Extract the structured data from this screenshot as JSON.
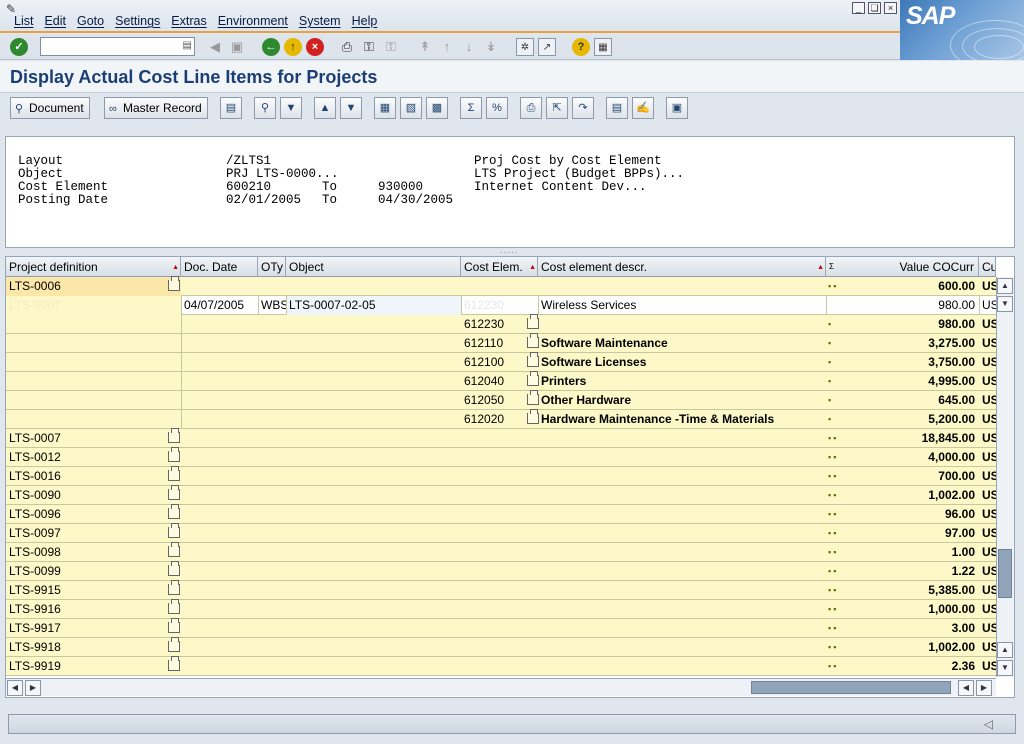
{
  "menu": [
    "List",
    "Edit",
    "Goto",
    "Settings",
    "Extras",
    "Environment",
    "System",
    "Help"
  ],
  "brand": "SAP",
  "page_title": "Display Actual Cost Line Items for Projects",
  "app_toolbar": {
    "document_label": "Document",
    "master_record_label": "Master Record"
  },
  "header": {
    "labels": [
      "Layout",
      "Object",
      "Cost Element",
      "Posting Date"
    ],
    "values": [
      "/ZLTS1",
      "PRJ LTS-0000...",
      "600210",
      "02/01/2005"
    ],
    "to_labels": [
      "To",
      "To"
    ],
    "to_values": [
      "930000",
      "04/30/2005"
    ],
    "descriptions": [
      "Proj Cost by Cost Element",
      "LTS Project (Budget BPPs)...",
      "Internet Content Dev..."
    ]
  },
  "columns": [
    "Project definition",
    "Doc. Date",
    "OTy",
    "Object",
    "Cost Elem.",
    "Cost element descr.",
    "Value COCurr",
    "Cu"
  ],
  "sum_marker": "Σ",
  "rows": [
    {
      "proj": "LTS-0006",
      "value": "600.00",
      "cur": "US",
      "dots": "▪▪",
      "type": "sum",
      "selected": true
    },
    {
      "proj": "LTS-0007",
      "date": "04/07/2005",
      "oty": "WBS",
      "object": "LTS-0007-02-05",
      "ce": "612230",
      "desc": "Wireless Services",
      "value": "980.00",
      "cur": "US",
      "type": "item"
    },
    {
      "ce": "612230",
      "value": "980.00",
      "cur": "US",
      "dots": "▪",
      "type": "sub"
    },
    {
      "ce": "612110",
      "desc": "Software Maintenance",
      "value": "3,275.00",
      "cur": "US",
      "dots": "▪",
      "type": "sub"
    },
    {
      "ce": "612100",
      "desc": "Software Licenses",
      "value": "3,750.00",
      "cur": "US",
      "dots": "▪",
      "type": "sub"
    },
    {
      "ce": "612040",
      "desc": "Printers",
      "value": "4,995.00",
      "cur": "US",
      "dots": "▪",
      "type": "sub"
    },
    {
      "ce": "612050",
      "desc": "Other Hardware",
      "value": "645.00",
      "cur": "US",
      "dots": "▪",
      "type": "sub"
    },
    {
      "ce": "612020",
      "desc": "Hardware Maintenance -Time & Materials",
      "value": "5,200.00",
      "cur": "US",
      "dots": "▪",
      "type": "sub"
    },
    {
      "proj": "LTS-0007",
      "value": "18,845.00",
      "cur": "US",
      "dots": "▪▪",
      "type": "sum"
    },
    {
      "proj": "LTS-0012",
      "value": "4,000.00",
      "cur": "US",
      "dots": "▪▪",
      "type": "sum"
    },
    {
      "proj": "LTS-0016",
      "value": "700.00",
      "cur": "US",
      "dots": "▪▪",
      "type": "sum"
    },
    {
      "proj": "LTS-0090",
      "value": "1,002.00",
      "cur": "US",
      "dots": "▪▪",
      "type": "sum"
    },
    {
      "proj": "LTS-0096",
      "value": "96.00",
      "cur": "US",
      "dots": "▪▪",
      "type": "sum"
    },
    {
      "proj": "LTS-0097",
      "value": "97.00",
      "cur": "US",
      "dots": "▪▪",
      "type": "sum"
    },
    {
      "proj": "LTS-0098",
      "value": "1.00",
      "cur": "US",
      "dots": "▪▪",
      "type": "sum"
    },
    {
      "proj": "LTS-0099",
      "value": "1.22",
      "cur": "US",
      "dots": "▪▪",
      "type": "sum"
    },
    {
      "proj": "LTS-9915",
      "value": "5,385.00",
      "cur": "US",
      "dots": "▪▪",
      "type": "sum"
    },
    {
      "proj": "LTS-9916",
      "value": "1,000.00",
      "cur": "US",
      "dots": "▪▪",
      "type": "sum"
    },
    {
      "proj": "LTS-9917",
      "value": "3.00",
      "cur": "US",
      "dots": "▪▪",
      "type": "sum"
    },
    {
      "proj": "LTS-9918",
      "value": "1,002.00",
      "cur": "US",
      "dots": "▪▪",
      "type": "sum"
    },
    {
      "proj": "LTS-9919",
      "value": "2.36",
      "cur": "US",
      "dots": "▪▪",
      "type": "sum"
    }
  ],
  "vscroll_thumb_fraction": 0.85
}
